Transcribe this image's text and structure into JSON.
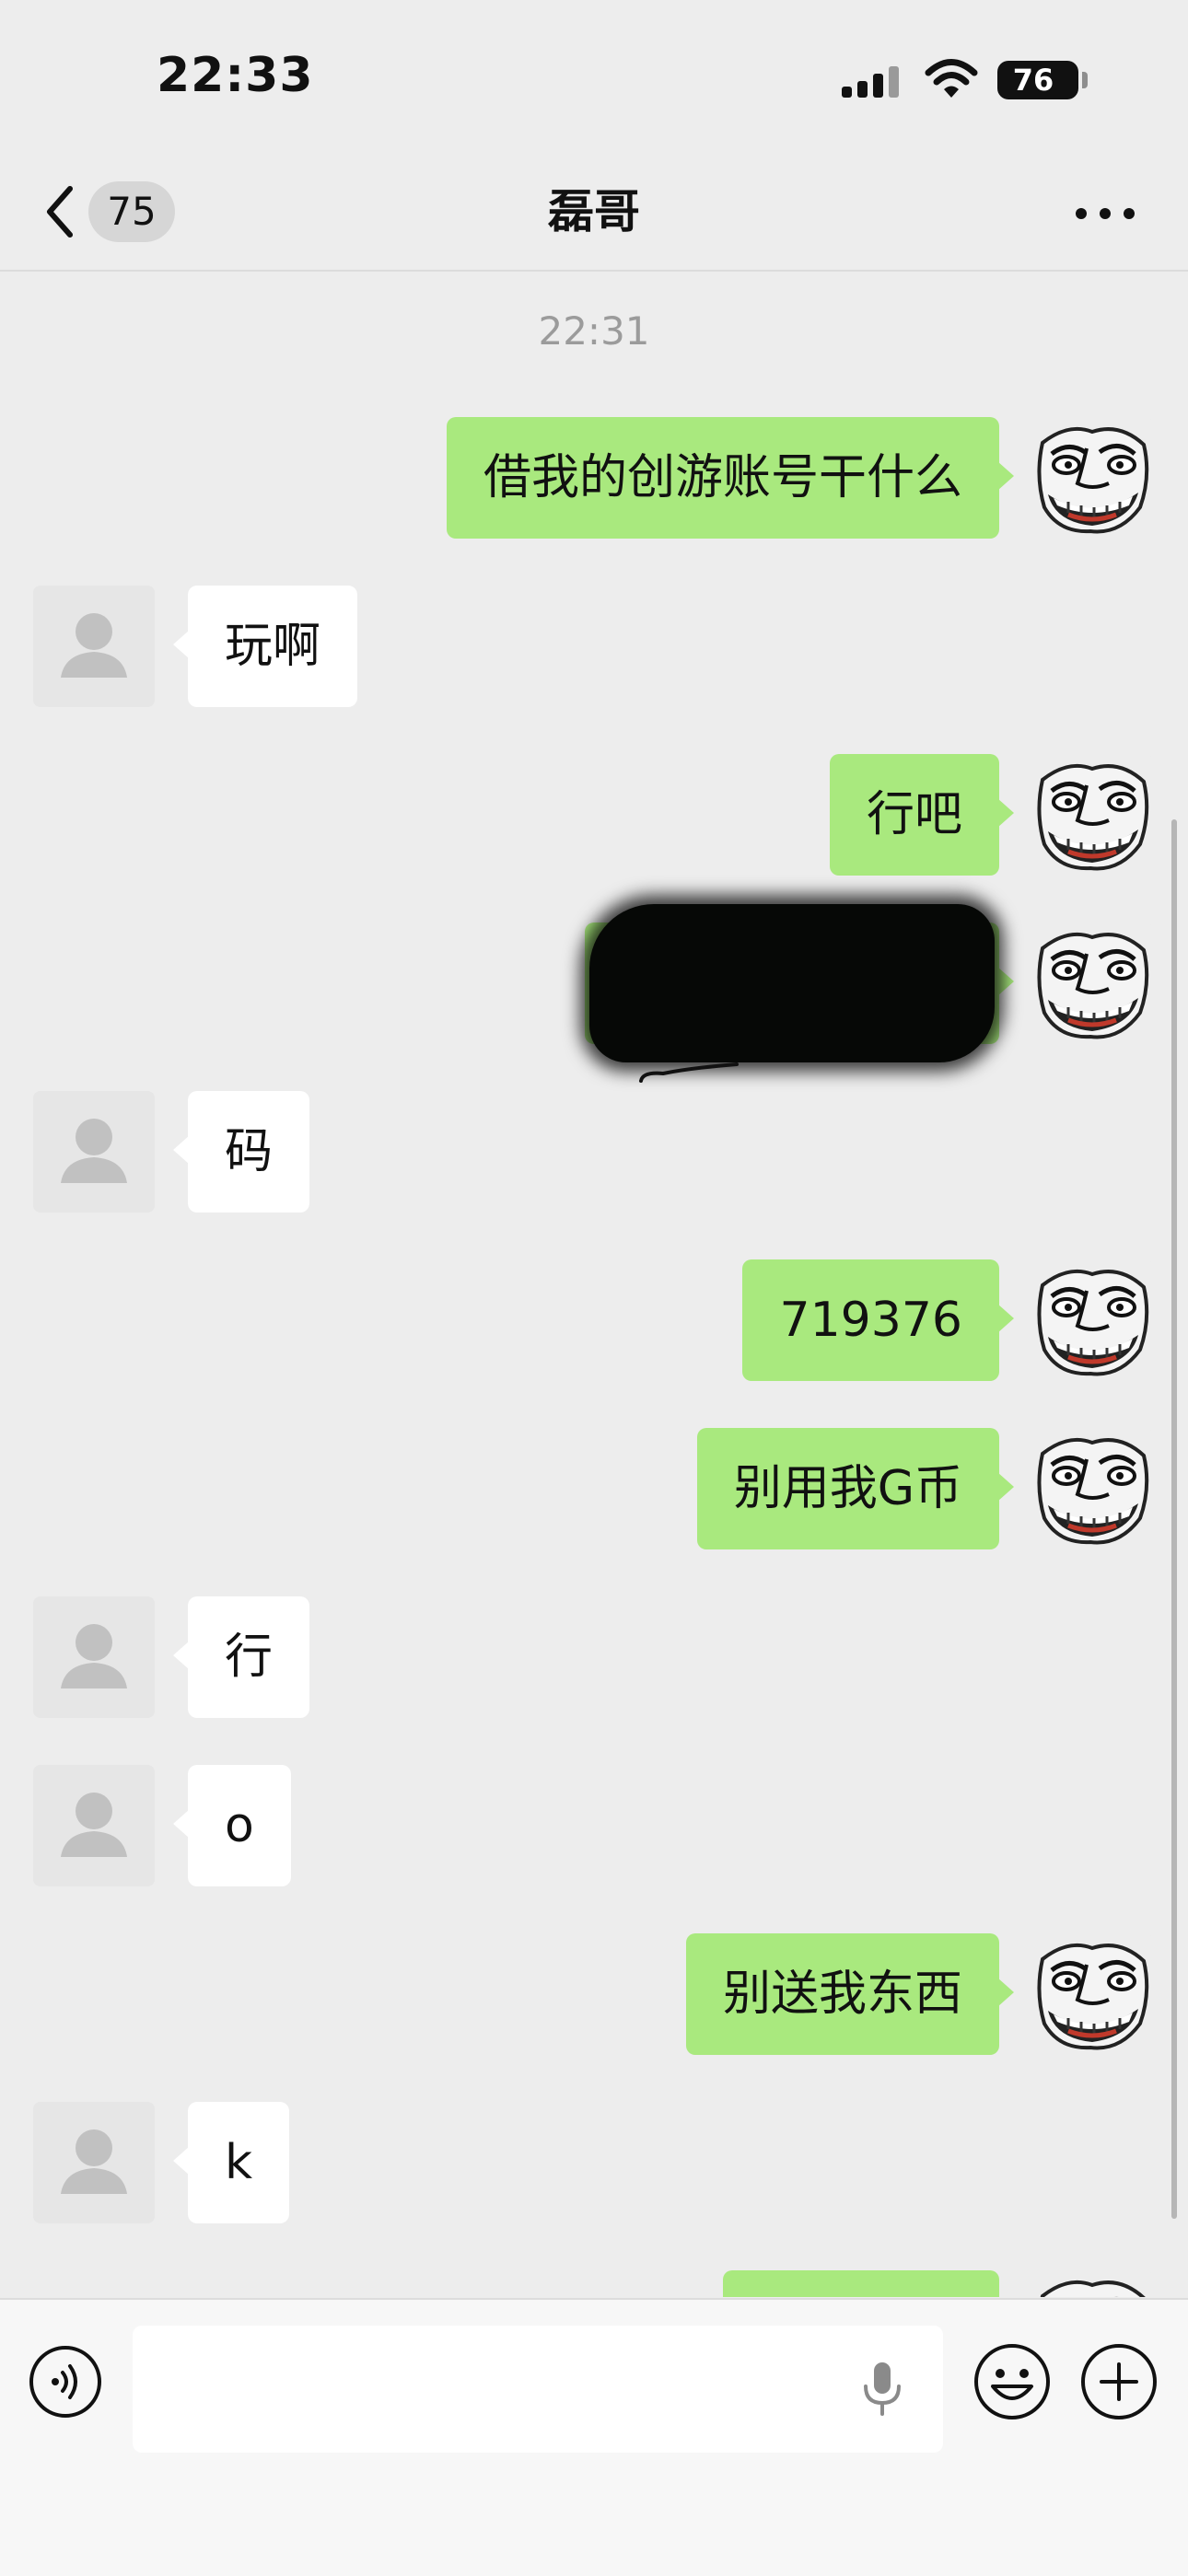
{
  "status_bar": {
    "time": "22:33",
    "battery": "76"
  },
  "nav": {
    "unread_count": "75",
    "title": "磊哥"
  },
  "chat": {
    "timestamp": "22:31",
    "messages": [
      {
        "from": "self",
        "text": "借我的创游账号干什么"
      },
      {
        "from": "other",
        "text": "玩啊"
      },
      {
        "from": "self",
        "text": "行吧"
      },
      {
        "from": "self",
        "text": "",
        "redacted": true
      },
      {
        "from": "other",
        "text": "码"
      },
      {
        "from": "self",
        "text": "719376"
      },
      {
        "from": "self",
        "text": "别用我G币"
      },
      {
        "from": "other",
        "text": "行"
      },
      {
        "from": "other",
        "text": "o"
      },
      {
        "from": "self",
        "text": "别送我东西"
      },
      {
        "from": "other",
        "text": "k"
      },
      {
        "from": "self",
        "text": ""
      }
    ]
  },
  "input": {
    "placeholder": ""
  },
  "colors": {
    "self_bubble": "#a9e97e",
    "other_bubble": "#ffffff",
    "background": "#ededed"
  }
}
